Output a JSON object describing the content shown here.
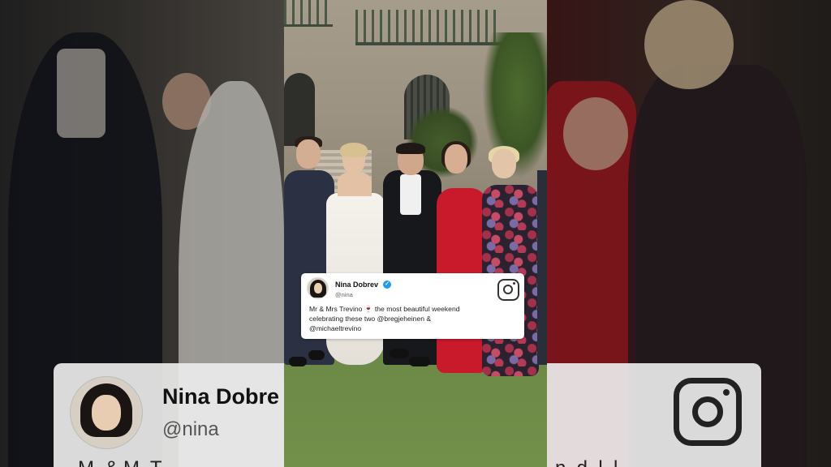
{
  "tweet": {
    "name": "Nina Dobrev",
    "handle": "@nina",
    "verified_glyph": "✓",
    "lines": [
      "Mr & Mrs Trevino 🍷 the most beautiful weekend",
      "celebrating these two @bregjeheinen &",
      "@michaeltrevino"
    ]
  },
  "background_card": {
    "name_partial": "Nina Dobre",
    "handle": "@nina",
    "body_partial": "M. & M. T.",
    "right_body_partial": "n. d. l. l."
  },
  "icons": {
    "social": "instagram-icon",
    "badge": "verified-badge-icon"
  },
  "colors": {
    "verified": "#1d9bf0",
    "card": "#ffffff",
    "red_dress": "#c81a2a",
    "lawn": "#6a8744"
  }
}
